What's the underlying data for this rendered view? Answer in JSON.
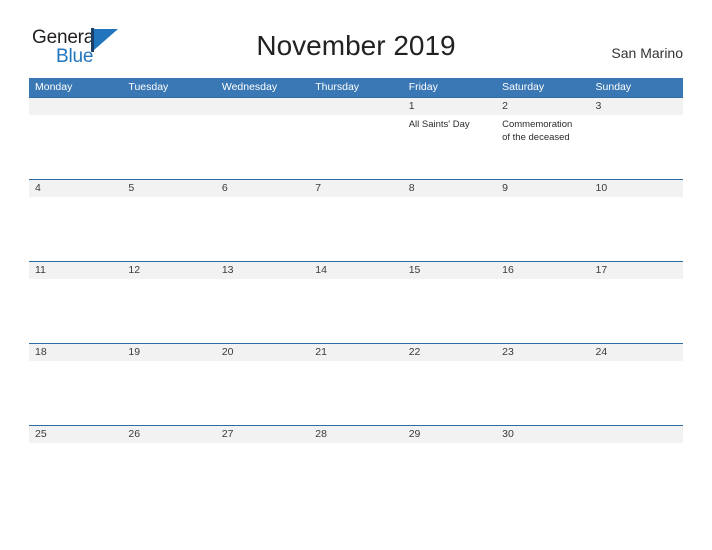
{
  "brand": {
    "name_part1": "General",
    "name_part2": "Blue",
    "flag_icon": "triangle-flag-icon",
    "accent_color": "#2175bd",
    "dark_color": "#231f20"
  },
  "header": {
    "title": "November 2019",
    "location": "San Marino"
  },
  "theme": {
    "header_blue": "#3a78b5",
    "rule_blue": "#2e6da4",
    "date_band_gray": "#f2f2f2",
    "page_background": "#ffffff"
  },
  "calendar": {
    "weekdays": [
      "Monday",
      "Tuesday",
      "Wednesday",
      "Thursday",
      "Friday",
      "Saturday",
      "Sunday"
    ],
    "weeks": [
      {
        "days": [
          {
            "date": "",
            "event": ""
          },
          {
            "date": "",
            "event": ""
          },
          {
            "date": "",
            "event": ""
          },
          {
            "date": "",
            "event": ""
          },
          {
            "date": "1",
            "event": "All Saints' Day"
          },
          {
            "date": "2",
            "event": "Commemoration of the deceased"
          },
          {
            "date": "3",
            "event": ""
          }
        ]
      },
      {
        "days": [
          {
            "date": "4",
            "event": ""
          },
          {
            "date": "5",
            "event": ""
          },
          {
            "date": "6",
            "event": ""
          },
          {
            "date": "7",
            "event": ""
          },
          {
            "date": "8",
            "event": ""
          },
          {
            "date": "9",
            "event": ""
          },
          {
            "date": "10",
            "event": ""
          }
        ]
      },
      {
        "days": [
          {
            "date": "11",
            "event": ""
          },
          {
            "date": "12",
            "event": ""
          },
          {
            "date": "13",
            "event": ""
          },
          {
            "date": "14",
            "event": ""
          },
          {
            "date": "15",
            "event": ""
          },
          {
            "date": "16",
            "event": ""
          },
          {
            "date": "17",
            "event": ""
          }
        ]
      },
      {
        "days": [
          {
            "date": "18",
            "event": ""
          },
          {
            "date": "19",
            "event": ""
          },
          {
            "date": "20",
            "event": ""
          },
          {
            "date": "21",
            "event": ""
          },
          {
            "date": "22",
            "event": ""
          },
          {
            "date": "23",
            "event": ""
          },
          {
            "date": "24",
            "event": ""
          }
        ]
      },
      {
        "days": [
          {
            "date": "25",
            "event": ""
          },
          {
            "date": "26",
            "event": ""
          },
          {
            "date": "27",
            "event": ""
          },
          {
            "date": "28",
            "event": ""
          },
          {
            "date": "29",
            "event": ""
          },
          {
            "date": "30",
            "event": ""
          },
          {
            "date": "",
            "event": ""
          }
        ]
      }
    ]
  }
}
